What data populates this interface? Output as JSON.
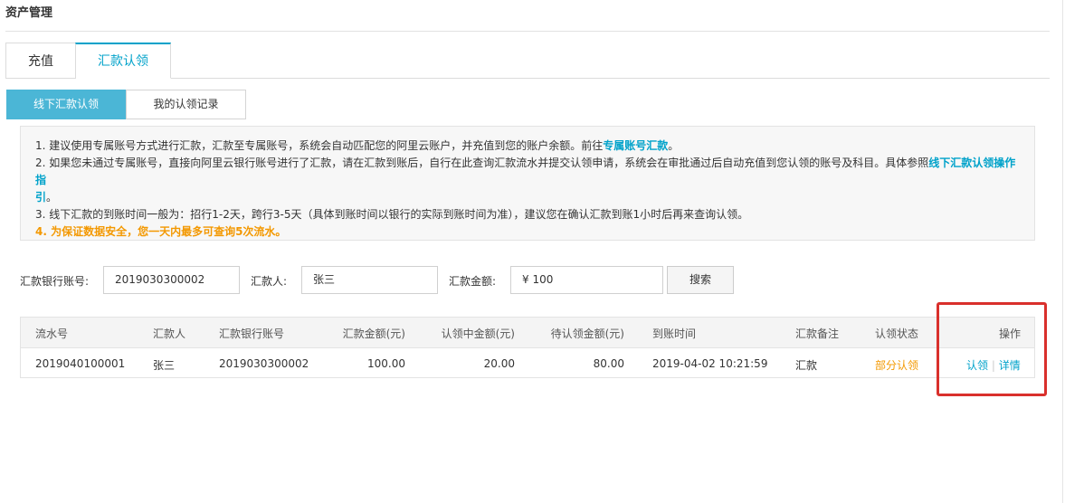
{
  "header": {
    "title": "资产管理"
  },
  "tabs": {
    "recharge": "充值",
    "claim": "汇款认领"
  },
  "subtabs": {
    "offline": "线下汇款认领",
    "records": "我的认领记录"
  },
  "notice": {
    "line1_text": "1. 建议使用专属账号方式进行汇款，汇款至专属账号，系统会自动匹配您的阿里云账户，并充值到您的账户余额。前往",
    "line1_link": "专属账号汇款",
    "line1_end": "。",
    "line2_text": "2. 如果您未通过专属账号，直接向阿里云银行账号进行了汇款，请在汇款到账后，自行在此查询汇款流水并提交认领申请，系统会在审批通过后自动充值到您认领的账号及科目。具体参照",
    "line2_link_a": "线下汇款认领操作指",
    "line2_link_b": "引",
    "line2_end": "。",
    "line3_text": "3. 线下汇款的到账时间一般为：招行1-2天，跨行3-5天（具体到账时间以银行的实际到账时间为准），建议您在确认汇款到账1小时后再来查询认领。",
    "line4_text": "4. 为保证数据安全，您一天内最多可查询5次流水。"
  },
  "search": {
    "bank_account_label": "汇款银行账号:",
    "bank_account_value": "2019030300002",
    "remitter_label": "汇款人:",
    "remitter_value": "张三",
    "amount_label": "汇款金额:",
    "amount_value": "¥  100",
    "search_button": "搜索"
  },
  "table": {
    "headers": {
      "serial": "流水号",
      "remitter": "汇款人",
      "bank_account": "汇款银行账号",
      "amount": "汇款金额(元)",
      "claiming": "认领中金额(元)",
      "pending": "待认领金额(元)",
      "arrival_time": "到账时间",
      "remark": "汇款备注",
      "status": "认领状态",
      "actions": "操作"
    },
    "rows": [
      {
        "serial": "2019040100001",
        "remitter": "张三",
        "bank_account": "2019030300002",
        "amount": "100.00",
        "claiming": "20.00",
        "pending": "80.00",
        "arrival_time": "2019-04-02 10:21:59",
        "remark": "汇款",
        "status": "部分认领",
        "action_claim": "认领",
        "action_separator": "|",
        "action_detail": "详情"
      }
    ]
  },
  "colors": {
    "accent": "#00a2ca",
    "subtab_active": "#4bb6d6",
    "warning": "#f39800",
    "highlight_box": "#d9302c"
  }
}
